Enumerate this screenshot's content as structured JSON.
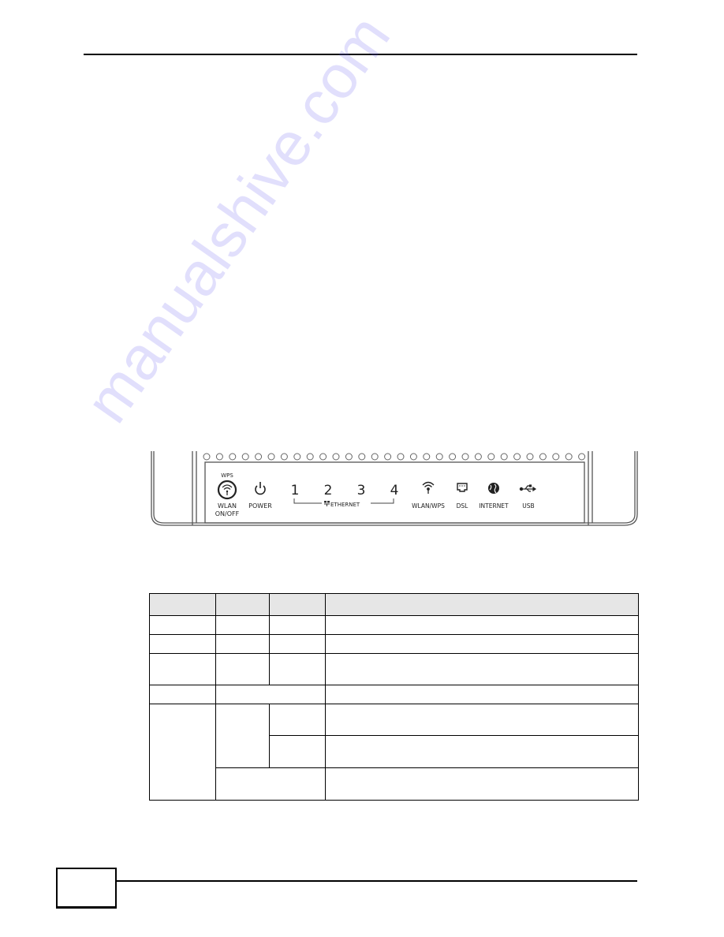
{
  "page": {
    "page_number": "",
    "header_text": "",
    "footer_text": ""
  },
  "figure": {
    "caption": "",
    "wps_label": "WPS",
    "wlan_label_line1": "WLAN",
    "wlan_label_line2": "ON/OFF",
    "power_label": "POWER",
    "ethernet_ports": [
      "1",
      "2",
      "3",
      "4"
    ],
    "ethernet_label": "ETHERNET",
    "wlan_wps_label": "WLAN/WPS",
    "dsl_label": "DSL",
    "internet_label": "INTERNET",
    "usb_label": "USB",
    "icons": [
      "wps-wifi-button-icon",
      "power-icon",
      "ethernet-icon",
      "wifi-icon",
      "dsl-port-icon",
      "globe-icon",
      "usb-icon"
    ]
  },
  "table": {
    "caption": "",
    "headers": [
      "",
      "",
      "",
      ""
    ],
    "rows": [
      [
        "",
        "",
        "",
        ""
      ],
      [
        "",
        "",
        "",
        ""
      ],
      [
        "",
        "",
        "",
        ""
      ],
      [
        "",
        "",
        ""
      ],
      [
        "",
        "",
        "",
        ""
      ],
      [
        "",
        ""
      ],
      [
        "",
        ""
      ]
    ]
  },
  "watermark": "manualshive.com"
}
